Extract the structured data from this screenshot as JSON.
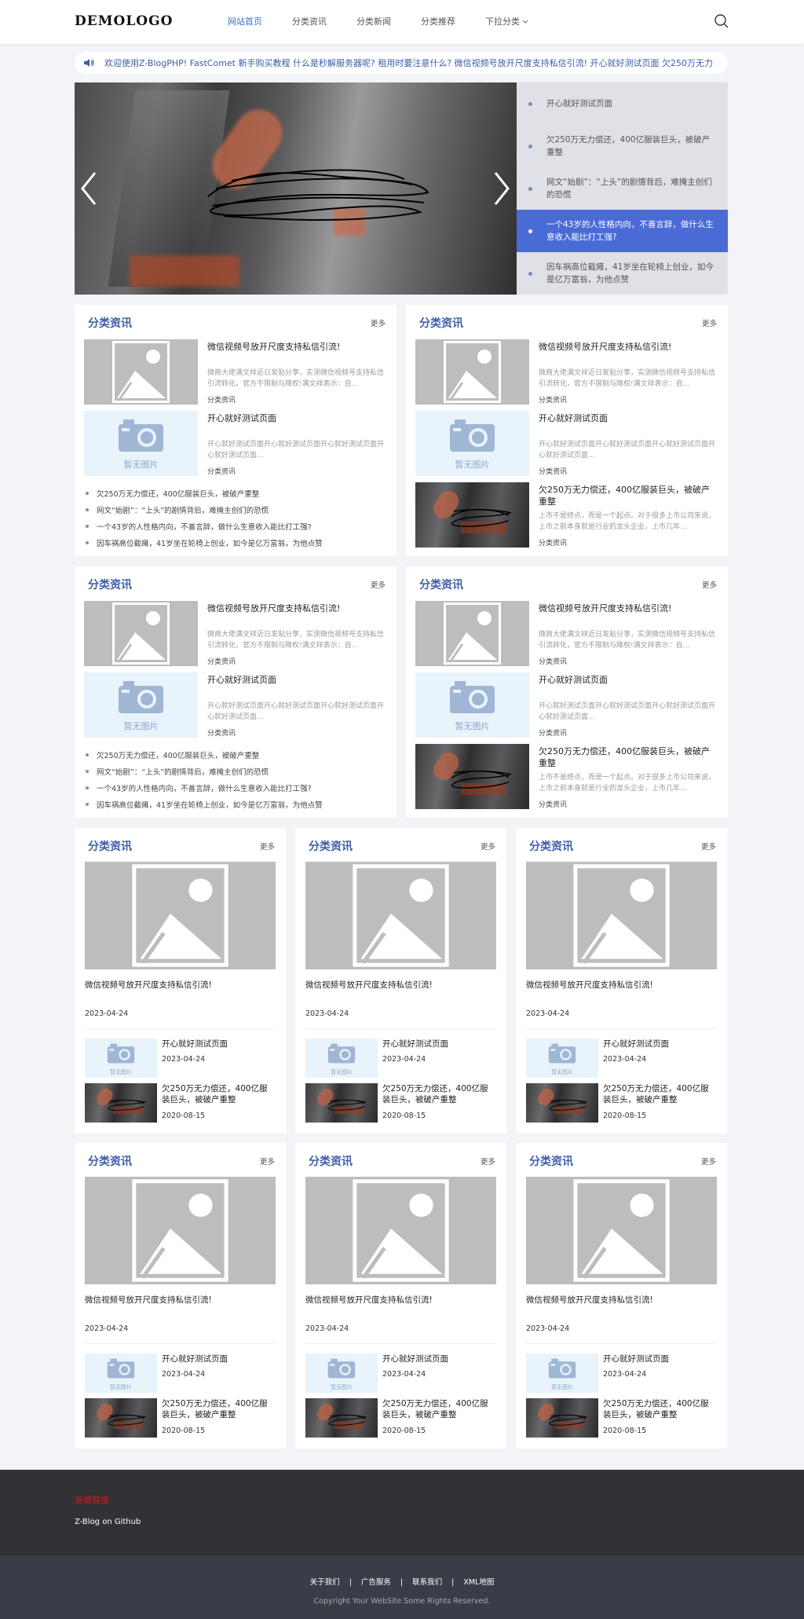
{
  "header": {
    "logo": "DEMOLOGO",
    "nav": [
      "网站首页",
      "分类资讯",
      "分类新闻",
      "分类推荐",
      "下拉分类"
    ],
    "active_index": 0
  },
  "notice": {
    "text": "欢迎使用Z-BlogPHP!  FastComet 新手购买教程 什么是秒解服务器呢? 租用时要注意什么? 微信视频号放开尺度支持私信引流!  开心就好测试页面 欠250万无力"
  },
  "slider": {
    "items": [
      "开心就好测试页面",
      "欠250万无力偿还，400亿服装巨头，被破产重整",
      "网文“始剧”：“上头”的剧情背后，难掩主创们的恐慌",
      "一个43岁的人性格内向，不善言辞，做什么生意收入能比打工强?",
      "因车祸高位截瘫，41岁坐在轮椅上创业，如今是亿万富翁，为他点赞"
    ],
    "active_index": 3
  },
  "wide_cards": [
    {
      "title": "分类资讯",
      "more": "更多",
      "media": [
        {
          "title": "微信视频号放开尺度支持私信引流!",
          "desc": "微商大佬满文祥近日发贴分享，实测微信视频号支持私信引流转化，官方不限制与降权!满文祥表示：自...",
          "cat": "分类资讯",
          "thumb": "placeholder"
        },
        {
          "title": "开心就好测试页面",
          "desc": "开心就好测试页面开心就好测试页面开心就好测试页面开心就好测试页面...",
          "cat": "分类资讯",
          "thumb": "camera",
          "thumb_label": "暂无图片"
        }
      ],
      "list": [
        "欠250万无力偿还，400亿服装巨头，被破产重整",
        "网文“始剧”：“上头”的剧情背后，难掩主创们的恐慌",
        "一个43岁的人性格内向，不善言辞，做什么生意收入能比打工强?",
        "因车祸高位截瘫，41岁坐在轮椅上创业，如今是亿万富翁，为他点赞"
      ]
    },
    {
      "title": "分类资讯",
      "more": "更多",
      "media": [
        {
          "title": "微信视频号放开尺度支持私信引流!",
          "desc": "微商大佬满文祥近日发贴分享，实测微信视频号支持私信引流转化，官方不限制与降权!满文祥表示：自...",
          "cat": "分类资讯",
          "thumb": "placeholder"
        },
        {
          "title": "开心就好测试页面",
          "desc": "开心就好测试页面开心就好测试页面开心就好测试页面开心就好测试页面...",
          "cat": "分类资讯",
          "thumb": "camera",
          "thumb_label": "暂无图片"
        },
        {
          "title": "欠250万无力偿还，400亿服装巨头，被破产重整",
          "desc": "上市不是终点，而是一个起点。对于很多上市公司来说，上市之前本身就是行业的龙头企业，上市几年...",
          "cat": "分类资讯",
          "thumb": "photo"
        }
      ],
      "list": []
    },
    {
      "title": "分类资讯",
      "more": "更多",
      "media": [
        {
          "title": "微信视频号放开尺度支持私信引流!",
          "desc": "微商大佬满文祥近日发贴分享，实测微信视频号支持私信引流转化，官方不限制与降权!满文祥表示：自...",
          "cat": "分类资讯",
          "thumb": "placeholder"
        },
        {
          "title": "开心就好测试页面",
          "desc": "开心就好测试页面开心就好测试页面开心就好测试页面开心就好测试页面...",
          "cat": "分类资讯",
          "thumb": "camera",
          "thumb_label": "暂无图片"
        }
      ],
      "list": [
        "欠250万无力偿还，400亿服装巨头，被破产重整",
        "网文“始剧”：“上头”的剧情背后，难掩主创们的恐慌",
        "一个43岁的人性格内向，不善言辞，做什么生意收入能比打工强?",
        "因车祸高位截瘫，41岁坐在轮椅上创业，如今是亿万富翁，为他点赞"
      ]
    },
    {
      "title": "分类资讯",
      "more": "更多",
      "media": [
        {
          "title": "微信视频号放开尺度支持私信引流!",
          "desc": "微商大佬满文祥近日发贴分享，实测微信视频号支持私信引流转化，官方不限制与降权!满文祥表示：自...",
          "cat": "分类资讯",
          "thumb": "placeholder"
        },
        {
          "title": "开心就好测试页面",
          "desc": "开心就好测试页面开心就好测试页面开心就好测试页面开心就好测试页面...",
          "cat": "分类资讯",
          "thumb": "camera",
          "thumb_label": "暂无图片"
        },
        {
          "title": "欠250万无力偿还，400亿服装巨头，被破产重整",
          "desc": "上市不是终点，而是一个起点。对于很多上市公司来说，上市之前本身就是行业的龙头企业，上市几年...",
          "cat": "分类资讯",
          "thumb": "photo"
        }
      ],
      "list": []
    }
  ],
  "small_card": {
    "title": "分类资讯",
    "more": "更多",
    "main_title": "微信视频号放开尺度支持私信引流!",
    "main_date": "2023-04-24",
    "rows": [
      {
        "title": "开心就好测试页面",
        "date": "2023-04-24",
        "thumb": "camera",
        "thumb_label": "暂无图片"
      },
      {
        "title": "欠250万无力偿还，400亿服装巨头，被破产重整",
        "date": "2020-08-15",
        "thumb": "photo"
      }
    ]
  },
  "footer": {
    "links_title": "友情链接",
    "link": "Z-Blog on Github",
    "nav": [
      "关于我们",
      "广告服务",
      "联系我们",
      "XML地图"
    ],
    "separator": "|",
    "copyright": "Copyright Your WebSite.Some Rights Reserved."
  },
  "colors": {
    "accent": "#3e5fa8",
    "active_slide": "#4a6bd6",
    "footer_bg": "#323135",
    "footer_link_title": "#d71b1b"
  }
}
